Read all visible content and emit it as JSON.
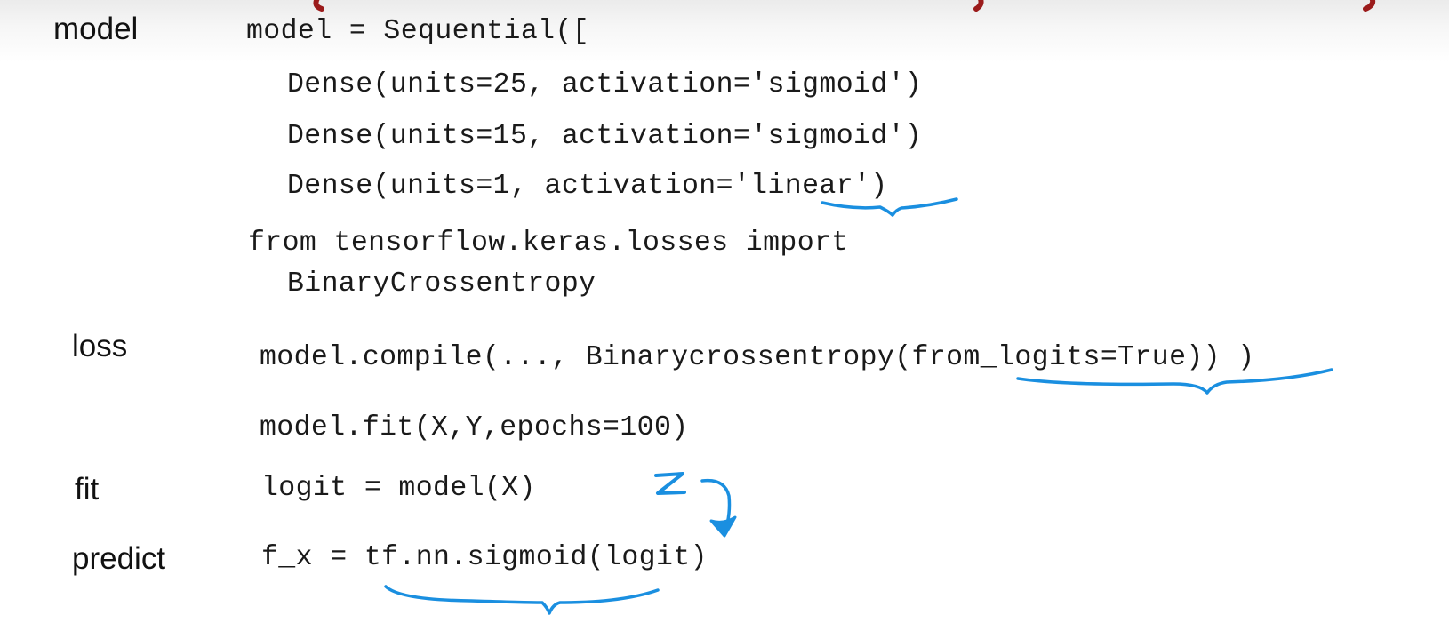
{
  "colors": {
    "ink_annotation": "#1a8fe0",
    "title_red": "#9b1b1b",
    "text": "#1a1a1a"
  },
  "labels": {
    "model": "model",
    "loss": "loss",
    "fit": "fit",
    "predict": "predict"
  },
  "code": {
    "sequential_open": "model = Sequential([",
    "dense1": "Dense(units=25, activation='sigmoid')",
    "dense2": "Dense(units=15, activation='sigmoid')",
    "dense3": "Dense(units=1, activation='linear')",
    "import_line": "from tensorflow.keras.losses import",
    "import_name": "BinaryCrossentropy",
    "compile": "model.compile(..., Binarycrossentropy(from_logits=True)) )",
    "fit": "model.fit(X,Y,epochs=100)",
    "logit": "logit = model(X)",
    "predict": "f_x = tf.nn.sigmoid(logit)"
  },
  "annotations": {
    "handwritten_z": "z"
  }
}
